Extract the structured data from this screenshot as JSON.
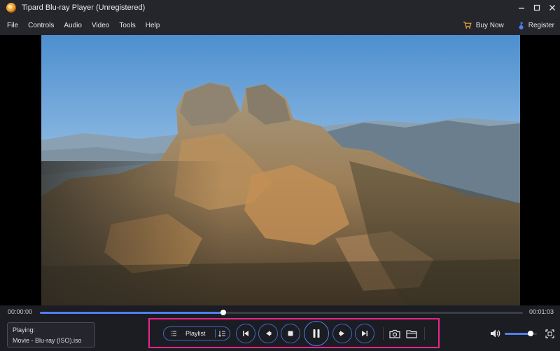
{
  "window": {
    "title": "Tipard Blu-ray Player (Unregistered)",
    "controls": [
      "minimize-icon",
      "maximize-icon",
      "close-icon"
    ]
  },
  "menu": {
    "items": [
      "File",
      "Controls",
      "Audio",
      "Video",
      "Tools",
      "Help"
    ],
    "buy_now": "Buy Now",
    "register": "Register"
  },
  "player": {
    "time_elapsed": "00:00:00",
    "time_total": "00:01:03",
    "progress": 0.38,
    "volume": 0.8,
    "now_playing_label": "Playing:",
    "now_playing_title": "Movie - Blu-ray (ISO).iso",
    "playlist_label": "Playlist",
    "state": "playing"
  },
  "colors": {
    "accent": "#4f7ff0",
    "control_outline": "#3f68c8",
    "highlight_frame": "#e8258b",
    "buy_cart": "#f0a53a",
    "register_key": "#4f7ff0"
  },
  "icons": {
    "app": "tipard-logo-icon",
    "playlist_menu": "list-icon",
    "playlist_sort": "sort-list-icon",
    "previous": "skip-previous-icon",
    "rewind": "rewind-icon",
    "stop": "stop-icon",
    "play_pause": "pause-icon",
    "forward": "fast-forward-icon",
    "next": "skip-next-icon",
    "snapshot": "camera-icon",
    "open": "folder-icon",
    "volume": "speaker-icon",
    "fullscreen": "fullscreen-icon"
  }
}
